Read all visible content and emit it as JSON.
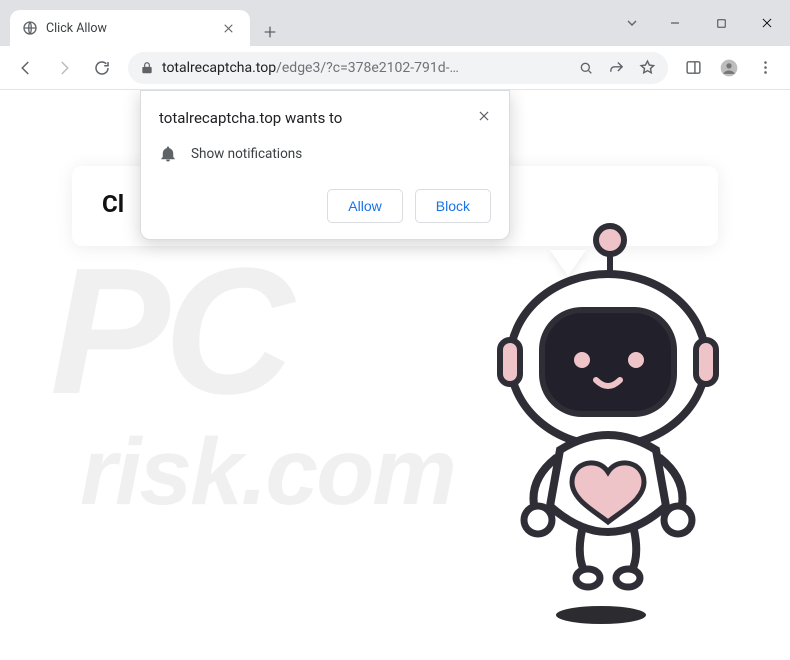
{
  "window": {
    "tab_title": "Click Allow"
  },
  "toolbar": {
    "url_host": "totalrecaptcha.top",
    "url_path": "/edge3/?c=378e2102-791d-…"
  },
  "page": {
    "card_title_partial": "Cl"
  },
  "permission_dialog": {
    "title": "totalrecaptcha.top wants to",
    "row_text": "Show notifications",
    "allow_label": "Allow",
    "block_label": "Block"
  },
  "watermark": {
    "line1": "PC",
    "line2": "risk.com"
  },
  "icons": {
    "globe": "globe-icon",
    "close": "close-icon",
    "plus": "plus-icon",
    "chevron": "chevron-down-icon",
    "minimize": "minimize-icon",
    "maximize": "maximize-icon",
    "window_close": "window-close-icon",
    "back": "back-icon",
    "forward": "forward-icon",
    "reload": "reload-icon",
    "lock": "lock-icon",
    "search": "search-icon",
    "share": "share-icon",
    "star": "star-icon",
    "panel": "panel-icon",
    "profile": "profile-icon",
    "menu": "menu-icon",
    "bell": "bell-icon"
  }
}
